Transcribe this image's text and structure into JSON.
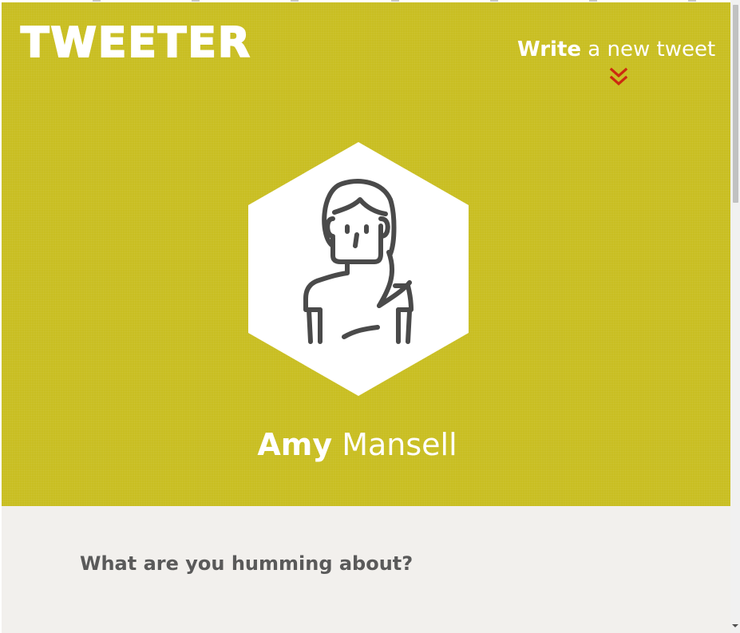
{
  "app": {
    "logo": "TWEETER"
  },
  "header": {
    "write_strong": "Write",
    "write_rest": " a new tweet",
    "chevron_icon": "double-chevron-down-icon",
    "accent_color": "#cc2a10",
    "background_color": "#c9be22"
  },
  "profile": {
    "first_name": "Amy",
    "last_name": " Mansell",
    "avatar_icon": "woman-avatar-icon"
  },
  "compose": {
    "prompt": "What are you humming about?",
    "background_color": "#f2f0ed"
  },
  "scrollbar": {
    "down_icon": "scroll-down-arrow-icon"
  }
}
